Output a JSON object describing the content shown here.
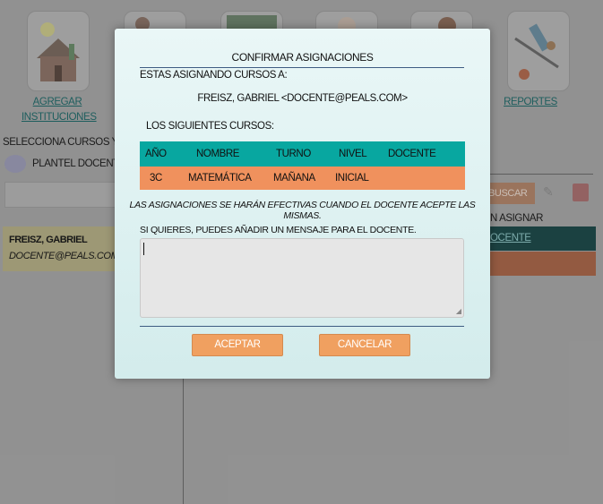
{
  "background": {
    "nav": {
      "agregar_instituciones": "AGREGAR INSTITUCIONES",
      "reportes": "REPORTES"
    },
    "selecciona_label": "SELECCIONA CURSOS Y ARRA",
    "plantel_label": "PLANTEL DOCENTE",
    "teacher_name": "FREISZ, GABRIEL",
    "teacher_email": "DOCENTE@PEALS.COM",
    "buscar_label": "BUSCAR",
    "sin_asignar_label": "N ASIGNAR",
    "docente_tab": "OCENTE"
  },
  "modal": {
    "title": "CONFIRMAR ASIGNACIONES",
    "assigning_label": "ESTAS ASIGNANDO CURSOS A:",
    "user": "FREISZ, GABRIEL <DOCENTE@PEALS.COM>",
    "courses_label": "LOS SIGUIENTES CURSOS:",
    "table": {
      "headers": [
        "AÑO",
        "NOMBRE",
        "TURNO",
        "NIVEL",
        "DOCENTE"
      ],
      "rows": [
        [
          "3C",
          "MATEMÁTICA",
          "MAÑANA",
          "INICIAL",
          ""
        ]
      ]
    },
    "note": "LAS ASIGNACIONES SE HARÁN EFECTIVAS CUANDO EL DOCENTE ACEPTE LAS MISMAS.",
    "message_label": "SI QUIERES, PUEDES AÑADIR UN MENSAJE PARA EL DOCENTE.",
    "message_value": "",
    "accept_label": "ACEPTAR",
    "cancel_label": "CANCELAR"
  },
  "colors": {
    "header_teal": "#08a7a0",
    "row_orange": "#f0915d",
    "button_orange": "#f0a060"
  }
}
